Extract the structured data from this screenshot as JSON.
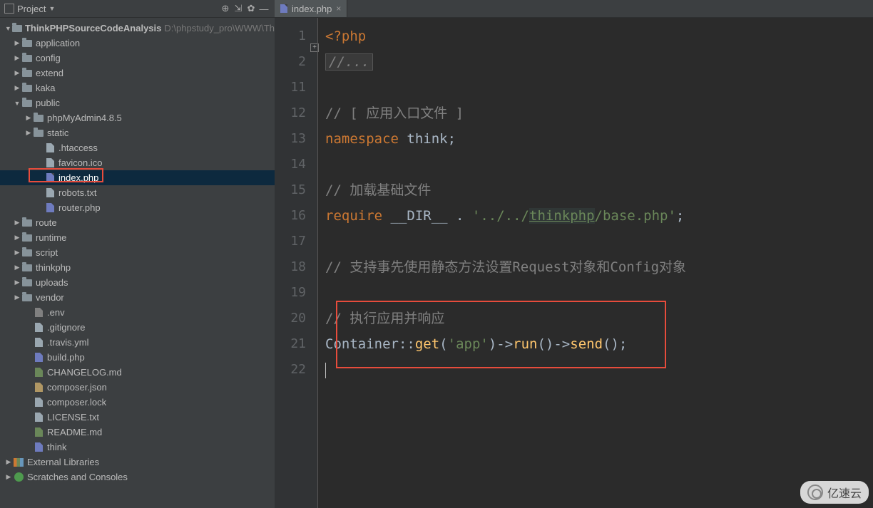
{
  "sidebar": {
    "title": "Project",
    "root": {
      "name": "ThinkPHPSourceCodeAnalysis",
      "path": "D:\\phpstudy_pro\\WWW\\Th"
    },
    "items": [
      {
        "label": "application",
        "type": "folder",
        "indent": 1,
        "arrow": "right"
      },
      {
        "label": "config",
        "type": "folder",
        "indent": 1,
        "arrow": "right"
      },
      {
        "label": "extend",
        "type": "folder",
        "indent": 1,
        "arrow": "right"
      },
      {
        "label": "kaka",
        "type": "folder",
        "indent": 1,
        "arrow": "right"
      },
      {
        "label": "public",
        "type": "folder",
        "indent": 1,
        "arrow": "down"
      },
      {
        "label": "phpMyAdmin4.8.5",
        "type": "folder",
        "indent": 2,
        "arrow": "right"
      },
      {
        "label": "static",
        "type": "folder",
        "indent": 2,
        "arrow": "right"
      },
      {
        "label": ".htaccess",
        "type": "file-txt",
        "indent": 3,
        "arrow": "none"
      },
      {
        "label": "favicon.ico",
        "type": "file-txt",
        "indent": 3,
        "arrow": "none"
      },
      {
        "label": "index.php",
        "type": "file-php",
        "indent": 3,
        "arrow": "none",
        "selected": true
      },
      {
        "label": "robots.txt",
        "type": "file-txt",
        "indent": 3,
        "arrow": "none"
      },
      {
        "label": "router.php",
        "type": "file-php",
        "indent": 3,
        "arrow": "none"
      },
      {
        "label": "route",
        "type": "folder",
        "indent": 1,
        "arrow": "right"
      },
      {
        "label": "runtime",
        "type": "folder",
        "indent": 1,
        "arrow": "right"
      },
      {
        "label": "script",
        "type": "folder",
        "indent": 1,
        "arrow": "right"
      },
      {
        "label": "thinkphp",
        "type": "folder",
        "indent": 1,
        "arrow": "right"
      },
      {
        "label": "uploads",
        "type": "folder",
        "indent": 1,
        "arrow": "right"
      },
      {
        "label": "vendor",
        "type": "folder",
        "indent": 1,
        "arrow": "right"
      },
      {
        "label": ".env",
        "type": "file-env",
        "indent": 2,
        "arrow": "none"
      },
      {
        "label": ".gitignore",
        "type": "file-txt",
        "indent": 2,
        "arrow": "none"
      },
      {
        "label": ".travis.yml",
        "type": "file-txt",
        "indent": 2,
        "arrow": "none"
      },
      {
        "label": "build.php",
        "type": "file-php",
        "indent": 2,
        "arrow": "none"
      },
      {
        "label": "CHANGELOG.md",
        "type": "file-md",
        "indent": 2,
        "arrow": "none"
      },
      {
        "label": "composer.json",
        "type": "file-json",
        "indent": 2,
        "arrow": "none"
      },
      {
        "label": "composer.lock",
        "type": "file-txt",
        "indent": 2,
        "arrow": "none"
      },
      {
        "label": "LICENSE.txt",
        "type": "file-txt",
        "indent": 2,
        "arrow": "none"
      },
      {
        "label": "README.md",
        "type": "file-md",
        "indent": 2,
        "arrow": "none"
      },
      {
        "label": "think",
        "type": "file-php",
        "indent": 2,
        "arrow": "none"
      }
    ],
    "external_libs": "External Libraries",
    "scratches": "Scratches and Consoles"
  },
  "editor": {
    "tab": {
      "filename": "index.php"
    },
    "line_numbers": [
      "1",
      "2",
      "11",
      "12",
      "13",
      "14",
      "15",
      "16",
      "17",
      "18",
      "19",
      "20",
      "21",
      "22"
    ],
    "code": {
      "l1_open": "<?php",
      "l2_folded": "//...",
      "l11_blank": "",
      "l12_comment": "// [ 应用入口文件 ]",
      "l13_namespace_kw": "namespace",
      "l13_namespace_id": " think",
      "l13_semi": ";",
      "l14_blank": "",
      "l15_comment": "// 加载基础文件",
      "l16_require_kw": "require",
      "l16_dir": " __DIR__ ",
      "l16_dot": ".",
      "l16_str1": " '../../",
      "l16_link": "thinkphp",
      "l16_str2": "/base.php'",
      "l16_semi": ";",
      "l17_blank": "",
      "l18_comment": "// 支持事先使用静态方法设置Request对象和Config对象",
      "l19_blank": "",
      "l20_comment": "// 执行应用并响应",
      "l21_class": "Container",
      "l21_scope": "::",
      "l21_get": "get",
      "l21_p1": "(",
      "l21_arg": "'app'",
      "l21_p2": ")->",
      "l21_run": "run",
      "l21_p3": "()->",
      "l21_send": "send",
      "l21_p4": "();"
    }
  },
  "watermark": "亿速云"
}
